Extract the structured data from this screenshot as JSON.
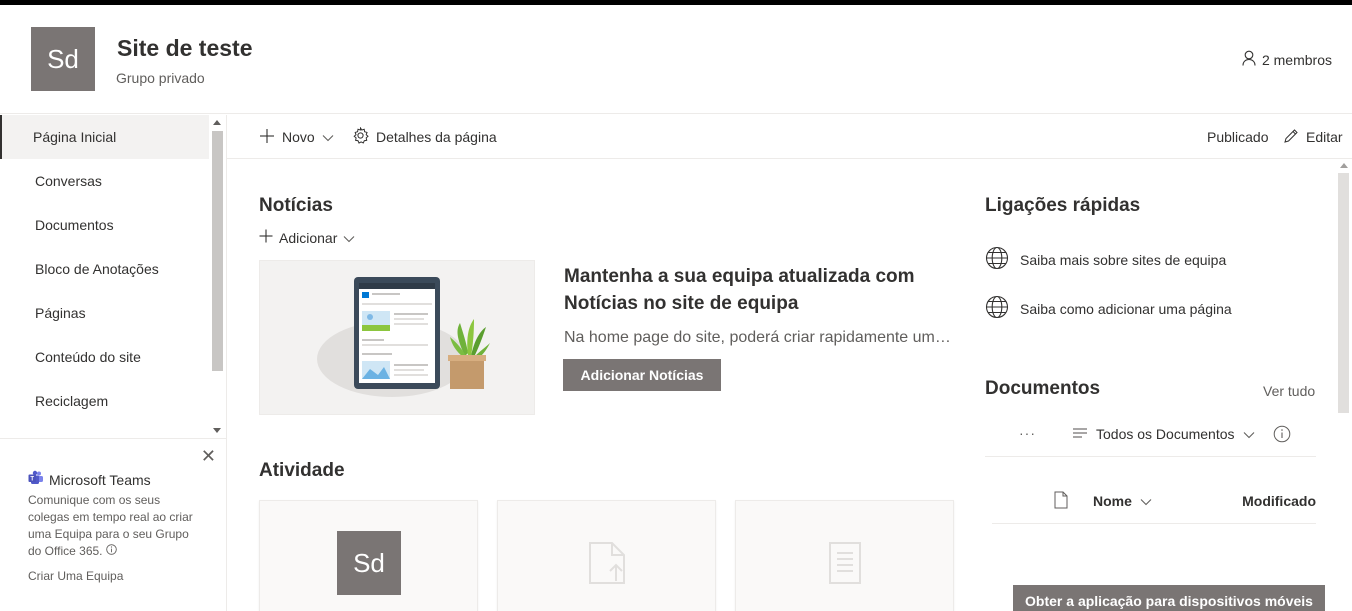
{
  "header": {
    "logo_text": "Sd",
    "site_title": "Site de teste",
    "site_subtitle": "Grupo privado",
    "members": "2 membros"
  },
  "nav": {
    "items": [
      {
        "label": "Página Inicial"
      },
      {
        "label": "Conversas"
      },
      {
        "label": "Documentos"
      },
      {
        "label": "Bloco de Anotações"
      },
      {
        "label": "Páginas"
      },
      {
        "label": "Conteúdo do site"
      },
      {
        "label": "Reciclagem"
      }
    ]
  },
  "teams": {
    "title": "Microsoft Teams",
    "body": "Comunique com os seus colegas em tempo real ao criar uma Equipa para o seu Grupo do Office 365.",
    "link": "Criar Uma Equipa"
  },
  "cmdbar": {
    "new_label": "Novo",
    "page_details_label": "Detalhes da página",
    "status": "Publicado",
    "edit_label": "Editar"
  },
  "news": {
    "title": "Notícias",
    "add_label": "Adicionar",
    "heading": "Mantenha a sua equipa atualizada com Notícias no site de equipa",
    "text": "Na home page do site, poderá criar rapidamente um…",
    "button": "Adicionar Notícias"
  },
  "activity": {
    "title": "Atividade",
    "logo_text": "Sd"
  },
  "quicklinks": {
    "title": "Ligações rápidas",
    "items": [
      {
        "label": "Saiba mais sobre sites de equipa"
      },
      {
        "label": "Saiba como adicionar uma página"
      }
    ]
  },
  "documents": {
    "title": "Documentos",
    "see_all": "Ver tudo",
    "more": "···",
    "view": "Todos os Documentos",
    "col_name": "Nome",
    "col_modified": "Modificado"
  },
  "mobile_button": "Obter a aplicação para dispositivos móveis",
  "colors": {
    "theme_gray": "#7a7574",
    "text": "#323130",
    "subtle_text": "#605e5c",
    "border": "#edebe9"
  },
  "icons": {
    "person": "person-icon",
    "plus": "plus-icon",
    "gear": "gear-icon",
    "pencil": "pencil-icon",
    "globe": "globe-icon",
    "teams": "teams-icon",
    "info": "info-icon",
    "file": "file-icon"
  }
}
